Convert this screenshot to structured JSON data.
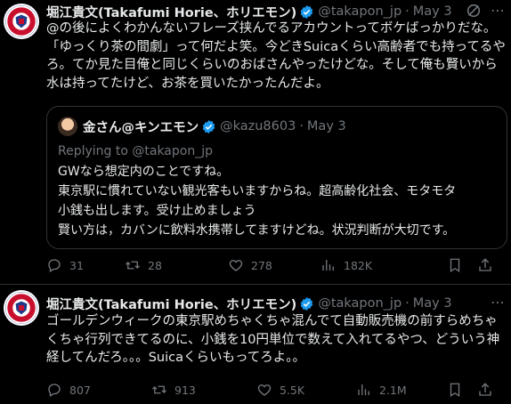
{
  "tweet1": {
    "name": "堀江貴文(Takafumi Horie、ホリエモン)",
    "handle": "@takapon_jp",
    "dot": "·",
    "date": "May 3",
    "text": "@の後によくわかんないフレーズ挟んでるアカウントってボケばっかりだな。「ゆっくり茶の間劇」って何だよ笑。今どきSuicaくらい高齢者でも持ってるやろ。てか見た目俺と同じくらいのおばさんやったけどな。そして俺も賢いから水は持ってたけど、お茶を買いたかったんだよ。",
    "quote": {
      "name": "金さん@キンエモン",
      "handle": "@kazu8603",
      "dot": "·",
      "date": "May 3",
      "replying": "Replying to @takapon_jp",
      "text": "GWなら想定内のことですね。\n東京駅に慣れていない観光客もいますからね。超高齢化社会、モタモタ\n小銭も出します。受け止めましょう\n賢い方は，カバンに飲料水携帯してますけどね。状況判断が大切です。"
    },
    "stats": {
      "replies": "31",
      "reposts": "28",
      "likes": "278",
      "views": "182K"
    }
  },
  "tweet2": {
    "name": "堀江貴文(Takafumi Horie、ホリエモン)",
    "handle": "@takapon_jp",
    "dot": "·",
    "date": "May 3",
    "text": "ゴールデンウィークの東京駅めちゃくちゃ混んでて自動販売機の前すらめちゃくちゃ行列できてるのに、小銭を10円単位で数えて入れてるやつ、どういう神経してんだろ。。。Suicaくらいもってろよ。。",
    "stats": {
      "replies": "807",
      "reposts": "913",
      "likes": "5.5K",
      "views": "2.1M"
    }
  },
  "colors": {
    "verified": "#1d9bf0",
    "muted": "#71767b",
    "background": "#000000",
    "border": "#2f3336"
  },
  "icons": [
    "verified-icon",
    "grok-icon",
    "more-icon",
    "reply-icon",
    "repost-icon",
    "like-icon",
    "views-icon",
    "bookmark-icon",
    "share-icon"
  ]
}
